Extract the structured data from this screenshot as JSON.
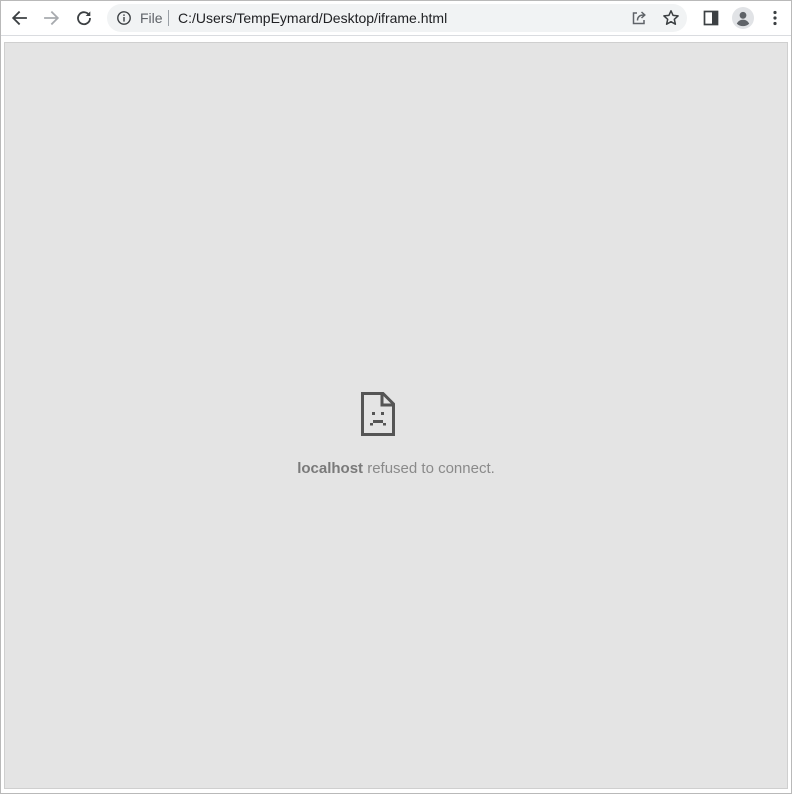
{
  "toolbar": {
    "back_icon": "arrow-left-icon",
    "forward_icon": "arrow-right-icon",
    "reload_icon": "reload-icon",
    "omnibox": {
      "info_icon": "info-circle-icon",
      "scheme": "File",
      "url": "C:/Users/TempEymard/Desktop/iframe.html",
      "share_icon": "share-icon",
      "bookmark_icon": "star-icon"
    },
    "side_panel_icon": "side-panel-icon",
    "profile_icon": "profile-avatar-icon",
    "menu_icon": "kebab-menu-icon"
  },
  "iframe": {
    "error_icon": "sad-document-icon",
    "host": "localhost",
    "message": " refused to connect."
  },
  "colors": {
    "iframe_background": "#e4e4e4",
    "omnibox_background": "#f1f3f4",
    "icon_color": "#5f6368",
    "error_icon_color": "#555555"
  }
}
